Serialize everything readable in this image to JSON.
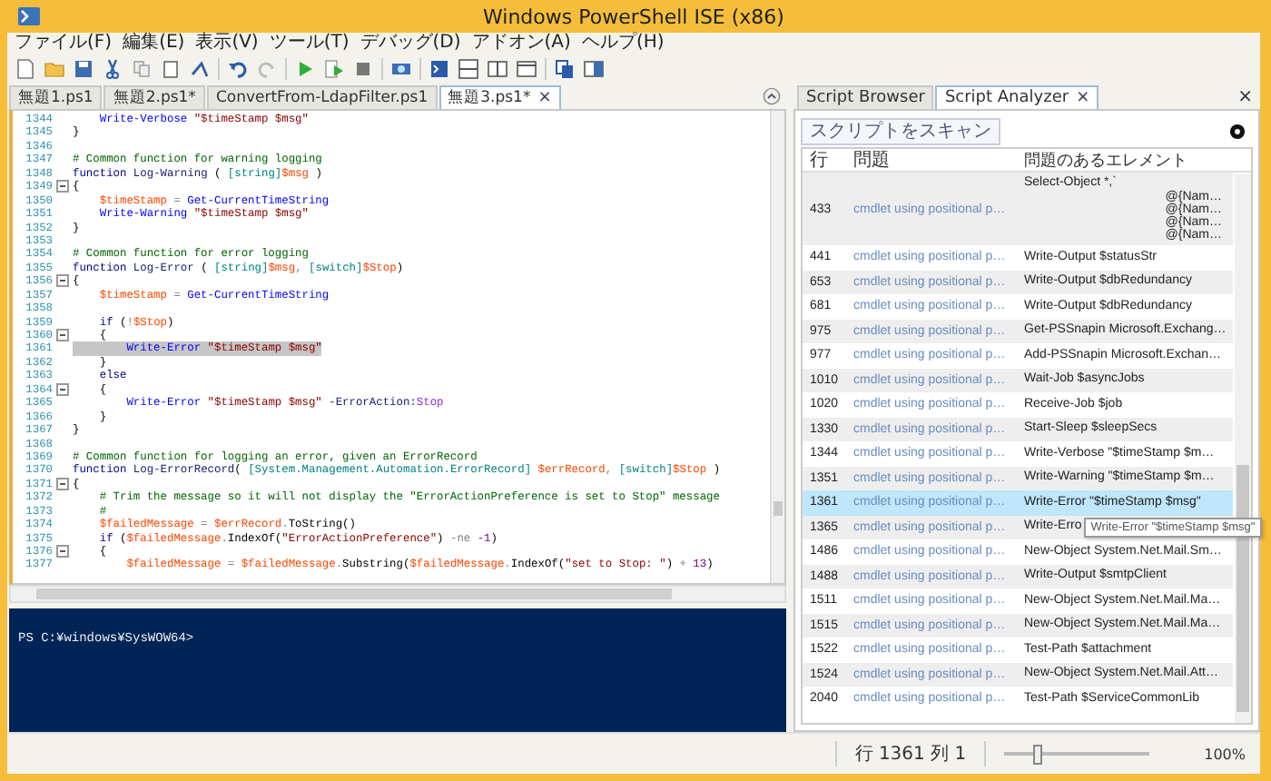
{
  "window": {
    "title": "Windows PowerShell ISE (x86)"
  },
  "menu": [
    "ファイル(F)",
    "編集(E)",
    "表示(V)",
    "ツール(T)",
    "デバッグ(D)",
    "アドオン(A)",
    "ヘルプ(H)"
  ],
  "file_tabs": [
    {
      "label": "無題1.ps1",
      "selected": false
    },
    {
      "label": "無題2.ps1*",
      "selected": false
    },
    {
      "label": "ConvertFrom-LdapFilter.ps1",
      "selected": false
    },
    {
      "label": "無題3.ps1*",
      "selected": true,
      "close": "×"
    }
  ],
  "editor": {
    "lines": [
      {
        "number": "1344",
        "fold": false,
        "highlighted": false,
        "tokens": [
          {
            "kind": "command",
            "text": "    Write-Verbose"
          },
          {
            "kind": "string",
            "text": " \"$timeStamp $msg\""
          }
        ]
      },
      {
        "number": "1345",
        "fold": false,
        "highlighted": false,
        "tokens": [
          {
            "kind": "plain",
            "text": "}"
          }
        ]
      },
      {
        "number": "1346",
        "fold": false,
        "highlighted": false
      },
      {
        "number": "1347",
        "fold": false,
        "highlighted": false,
        "tokens": [
          {
            "kind": "comment",
            "text": "# Common function for warning logging"
          }
        ]
      },
      {
        "number": "1348",
        "fold": false,
        "highlighted": false,
        "tokens": [
          {
            "kind": "keyword",
            "text": "function"
          },
          {
            "kind": "name",
            "text": " Log-Warning"
          },
          {
            "kind": "plain",
            "text": " ( "
          },
          {
            "kind": "type",
            "text": "[string]"
          },
          {
            "kind": "variable",
            "text": "$msg"
          },
          {
            "kind": "plain",
            "text": " )"
          }
        ]
      },
      {
        "number": "1349",
        "fold": true,
        "highlighted": false,
        "tokens": [
          {
            "kind": "plain",
            "text": "{"
          }
        ]
      },
      {
        "number": "1350",
        "fold": false,
        "highlighted": false,
        "tokens": [
          {
            "kind": "variable",
            "text": "    $timeStamp"
          },
          {
            "kind": "operator",
            "text": " = "
          },
          {
            "kind": "command",
            "text": "Get-CurrentTimeString"
          }
        ]
      },
      {
        "number": "1351",
        "fold": false,
        "highlighted": false,
        "tokens": [
          {
            "kind": "command",
            "text": "    Write-Warning"
          },
          {
            "kind": "string",
            "text": " \"$timeStamp $msg\""
          }
        ]
      },
      {
        "number": "1352",
        "fold": false,
        "highlighted": false,
        "tokens": [
          {
            "kind": "plain",
            "text": "}"
          }
        ]
      },
      {
        "number": "1353",
        "fold": false,
        "highlighted": false
      },
      {
        "number": "1354",
        "fold": false,
        "highlighted": false,
        "tokens": [
          {
            "kind": "comment",
            "text": "# Common function for error logging"
          }
        ]
      },
      {
        "number": "1355",
        "fold": false,
        "highlighted": false,
        "tokens": [
          {
            "kind": "keyword",
            "text": "function"
          },
          {
            "kind": "name",
            "text": " Log-Error"
          },
          {
            "kind": "plain",
            "text": " ( "
          },
          {
            "kind": "type",
            "text": "[string]"
          },
          {
            "kind": "variable",
            "text": "$msg"
          },
          {
            "kind": "operator",
            "text": ", "
          },
          {
            "kind": "type",
            "text": "[switch]"
          },
          {
            "kind": "variable",
            "text": "$Stop"
          },
          {
            "kind": "plain",
            "text": ")"
          }
        ]
      },
      {
        "number": "1356",
        "fold": true,
        "highlighted": false,
        "tokens": [
          {
            "kind": "plain",
            "text": "{"
          }
        ]
      },
      {
        "number": "1357",
        "fold": false,
        "highlighted": false,
        "tokens": [
          {
            "kind": "variable",
            "text": "    $timeStamp"
          },
          {
            "kind": "operator",
            "text": " = "
          },
          {
            "kind": "command",
            "text": "Get-CurrentTimeString"
          }
        ]
      },
      {
        "number": "1358",
        "fold": false,
        "highlighted": false
      },
      {
        "number": "1359",
        "fold": false,
        "highlighted": false,
        "tokens": [
          {
            "kind": "keyword",
            "text": "    if"
          },
          {
            "kind": "plain",
            "text": " ("
          },
          {
            "kind": "operator",
            "text": "!"
          },
          {
            "kind": "variable",
            "text": "$Stop"
          },
          {
            "kind": "plain",
            "text": ")"
          }
        ]
      },
      {
        "number": "1360",
        "fold": true,
        "highlighted": false,
        "tokens": [
          {
            "kind": "plain",
            "text": "    {"
          }
        ]
      },
      {
        "number": "1361",
        "fold": false,
        "highlighted": true,
        "tokens": [
          {
            "kind": "command",
            "text": "        Write-Error"
          },
          {
            "kind": "string",
            "text": " \"$timeStamp $msg\""
          }
        ]
      },
      {
        "number": "1362",
        "fold": false,
        "highlighted": false,
        "tokens": [
          {
            "kind": "plain",
            "text": "    }"
          }
        ]
      },
      {
        "number": "1363",
        "fold": false,
        "highlighted": false,
        "tokens": [
          {
            "kind": "keyword",
            "text": "    else"
          }
        ]
      },
      {
        "number": "1364",
        "fold": true,
        "highlighted": false,
        "tokens": [
          {
            "kind": "plain",
            "text": "    {"
          }
        ]
      },
      {
        "number": "1365",
        "fold": false,
        "highlighted": false,
        "tokens": [
          {
            "kind": "command",
            "text": "        Write-Error"
          },
          {
            "kind": "string",
            "text": " \"$timeStamp $msg\""
          },
          {
            "kind": "name",
            "text": " -ErrorAction:"
          },
          {
            "kind": "argument",
            "text": "Stop"
          }
        ]
      },
      {
        "number": "1366",
        "fold": false,
        "highlighted": false,
        "tokens": [
          {
            "kind": "plain",
            "text": "    }"
          }
        ]
      },
      {
        "number": "1367",
        "fold": false,
        "highlighted": false,
        "tokens": [
          {
            "kind": "plain",
            "text": "}"
          }
        ]
      },
      {
        "number": "1368",
        "fold": false,
        "highlighted": false
      },
      {
        "number": "1369",
        "fold": false,
        "highlighted": false,
        "tokens": [
          {
            "kind": "comment",
            "text": "# Common function for logging an error, given an ErrorRecord"
          }
        ]
      },
      {
        "number": "1370",
        "fold": false,
        "highlighted": false,
        "tokens": [
          {
            "kind": "keyword",
            "text": "function"
          },
          {
            "kind": "name",
            "text": " Log-ErrorRecord"
          },
          {
            "kind": "plain",
            "text": "( "
          },
          {
            "kind": "type",
            "text": "[System.Management.Automation.ErrorRecord]"
          },
          {
            "kind": "variable",
            "text": " $errRecord"
          },
          {
            "kind": "operator",
            "text": ", "
          },
          {
            "kind": "type",
            "text": "[switch]"
          },
          {
            "kind": "variable",
            "text": "$Stop"
          },
          {
            "kind": "plain",
            "text": " )"
          }
        ]
      },
      {
        "number": "1371",
        "fold": true,
        "highlighted": false,
        "tokens": [
          {
            "kind": "plain",
            "text": "{"
          }
        ]
      },
      {
        "number": "1372",
        "fold": false,
        "highlighted": false,
        "tokens": [
          {
            "kind": "comment",
            "text": "    # Trim the message so it will not display the \"ErrorActionPreference is set to Stop\" message"
          }
        ]
      },
      {
        "number": "1373",
        "fold": false,
        "highlighted": false,
        "tokens": [
          {
            "kind": "comment",
            "text": "    #"
          }
        ]
      },
      {
        "number": "1374",
        "fold": false,
        "highlighted": false,
        "tokens": [
          {
            "kind": "variable",
            "text": "    $failedMessage"
          },
          {
            "kind": "operator",
            "text": " = "
          },
          {
            "kind": "variable",
            "text": "$errRecord"
          },
          {
            "kind": "operator",
            "text": "."
          },
          {
            "kind": "member",
            "text": "ToString()"
          }
        ]
      },
      {
        "number": "1375",
        "fold": false,
        "highlighted": false,
        "tokens": [
          {
            "kind": "keyword",
            "text": "    if"
          },
          {
            "kind": "plain",
            "text": " ("
          },
          {
            "kind": "variable",
            "text": "$failedMessage"
          },
          {
            "kind": "operator",
            "text": "."
          },
          {
            "kind": "member",
            "text": "IndexOf("
          },
          {
            "kind": "string",
            "text": "\"ErrorActionPreference\""
          },
          {
            "kind": "plain",
            "text": ") "
          },
          {
            "kind": "operator",
            "text": "-ne"
          },
          {
            "kind": "number",
            "text": " -1"
          },
          {
            "kind": "plain",
            "text": ")"
          }
        ]
      },
      {
        "number": "1376",
        "fold": true,
        "highlighted": false,
        "tokens": [
          {
            "kind": "plain",
            "text": "    {"
          }
        ]
      },
      {
        "number": "1377",
        "fold": false,
        "highlighted": false,
        "tokens": [
          {
            "kind": "variable",
            "text": "        $failedMessage"
          },
          {
            "kind": "operator",
            "text": " = "
          },
          {
            "kind": "variable",
            "text": "$failedMessage"
          },
          {
            "kind": "operator",
            "text": "."
          },
          {
            "kind": "member",
            "text": "Substring("
          },
          {
            "kind": "variable",
            "text": "$failedMessage"
          },
          {
            "kind": "operator",
            "text": "."
          },
          {
            "kind": "member",
            "text": "IndexOf("
          },
          {
            "kind": "string",
            "text": "\"set to Stop: \""
          },
          {
            "kind": "plain",
            "text": ") "
          },
          {
            "kind": "operator",
            "text": "+"
          },
          {
            "kind": "number",
            "text": " 13"
          },
          {
            "kind": "plain",
            "text": ")"
          }
        ]
      }
    ]
  },
  "console": {
    "prompt": "PS C:¥windows¥SysWOW64>"
  },
  "side_tabs": [
    {
      "label": "Script Browser",
      "selected": false
    },
    {
      "label": "Script Analyzer",
      "selected": true,
      "close": "×"
    }
  ],
  "panel_close": "×",
  "scan_button": "スクリプトをスキャン",
  "analyzer": {
    "columns": [
      "行",
      "問題",
      "問題のあるエレメント"
    ],
    "rows": [
      {
        "line": "433",
        "issue": "cmdlet using positional p…",
        "element": [
          "Select-Object  *,`",
          "@{Nam…",
          "@{Nam…",
          "@{Nam…",
          "@{Nam…"
        ],
        "selected": false
      },
      {
        "line": "441",
        "issue": "cmdlet using positional p…",
        "element": [
          "Write-Output $statusStr"
        ],
        "selected": false
      },
      {
        "line": "653",
        "issue": "cmdlet using positional p…",
        "element": [
          "Write-Output $dbRedundancy"
        ],
        "selected": false
      },
      {
        "line": "681",
        "issue": "cmdlet using positional p…",
        "element": [
          "Write-Output $dbRedundancy"
        ],
        "selected": false
      },
      {
        "line": "975",
        "issue": "cmdlet using positional p…",
        "element": [
          "Get-PSSnapin Microsoft.Exchang…"
        ],
        "selected": false
      },
      {
        "line": "977",
        "issue": "cmdlet using positional p…",
        "element": [
          "Add-PSSnapin Microsoft.Exchan…"
        ],
        "selected": false
      },
      {
        "line": "1010",
        "issue": "cmdlet using positional p…",
        "element": [
          "Wait-Job $asyncJobs"
        ],
        "selected": false
      },
      {
        "line": "1020",
        "issue": "cmdlet using positional p…",
        "element": [
          "Receive-Job $job"
        ],
        "selected": false
      },
      {
        "line": "1330",
        "issue": "cmdlet using positional p…",
        "element": [
          "Start-Sleep $sleepSecs"
        ],
        "selected": false
      },
      {
        "line": "1344",
        "issue": "cmdlet using positional p…",
        "element": [
          "Write-Verbose \"$timeStamp $m…"
        ],
        "selected": false
      },
      {
        "line": "1351",
        "issue": "cmdlet using positional p…",
        "element": [
          "Write-Warning \"$timeStamp $m…"
        ],
        "selected": false
      },
      {
        "line": "1361",
        "issue": "cmdlet using positional p…",
        "element": [
          "Write-Error \"$timeStamp $msg\""
        ],
        "selected": true
      },
      {
        "line": "1365",
        "issue": "cmdlet using positional p…",
        "element": [
          "Write-Erro"
        ],
        "selected": false,
        "tooltip": "Write-Error \"$timeStamp $msg\""
      },
      {
        "line": "1486",
        "issue": "cmdlet using positional p…",
        "element": [
          "New-Object System.Net.Mail.Sm…"
        ],
        "selected": false
      },
      {
        "line": "1488",
        "issue": "cmdlet using positional p…",
        "element": [
          "Write-Output $smtpClient"
        ],
        "selected": false
      },
      {
        "line": "1511",
        "issue": "cmdlet using positional p…",
        "element": [
          "New-Object System.Net.Mail.Ma…"
        ],
        "selected": false
      },
      {
        "line": "1515",
        "issue": "cmdlet using positional p…",
        "element": [
          "New-Object System.Net.Mail.Ma…"
        ],
        "selected": false
      },
      {
        "line": "1522",
        "issue": "cmdlet using positional p…",
        "element": [
          "Test-Path $attachment"
        ],
        "selected": false
      },
      {
        "line": "1524",
        "issue": "cmdlet using positional p…",
        "element": [
          "New-Object System.Net.Mail.Att…"
        ],
        "selected": false
      },
      {
        "line": "2040",
        "issue": "cmdlet using positional p…",
        "element": [
          "Test-Path $ServiceCommonLib"
        ],
        "selected": false
      }
    ]
  },
  "status_bar": {
    "position": "行 1361 列 1",
    "zoom": {
      "level": 0.2,
      "reading": "100%"
    }
  }
}
